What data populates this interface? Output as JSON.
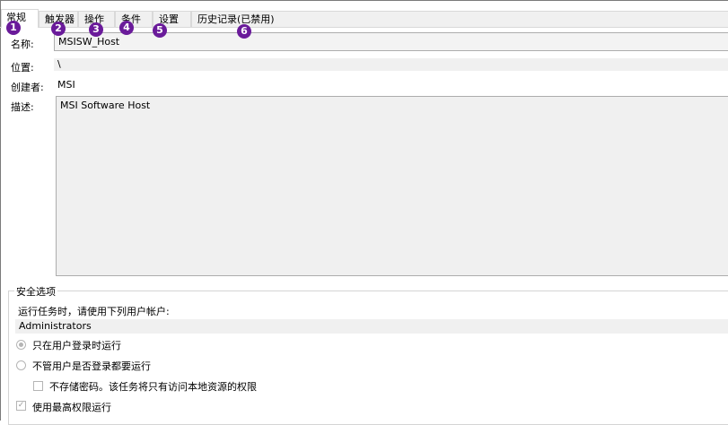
{
  "tabs": [
    {
      "label": "常规",
      "badge": "1",
      "active": true
    },
    {
      "label": "触发器",
      "badge": "2"
    },
    {
      "label": "操作",
      "badge": "3"
    },
    {
      "label": "条件",
      "badge": "4"
    },
    {
      "label": "设置",
      "badge": "5"
    },
    {
      "label": "历史记录(已禁用)",
      "badge": "6"
    }
  ],
  "general": {
    "name_label": "名称:",
    "name_value": "MSISW_Host",
    "location_label": "位置:",
    "location_value": "\\",
    "author_label": "创建者:",
    "author_value": "MSI",
    "description_label": "描述:",
    "description_value": "MSI Software Host"
  },
  "security": {
    "title": "安全选项",
    "run_as_label": "运行任务时，请使用下列用户帐户:",
    "account": "Administrators",
    "option_logged_on": "只在用户登录时运行",
    "option_whether_logged": "不管用户是否登录都要运行",
    "do_not_store_password": "不存储密码。该任务将只有访问本地资源的权限",
    "highest_privileges": "使用最高权限运行",
    "check_mark": "✓"
  }
}
